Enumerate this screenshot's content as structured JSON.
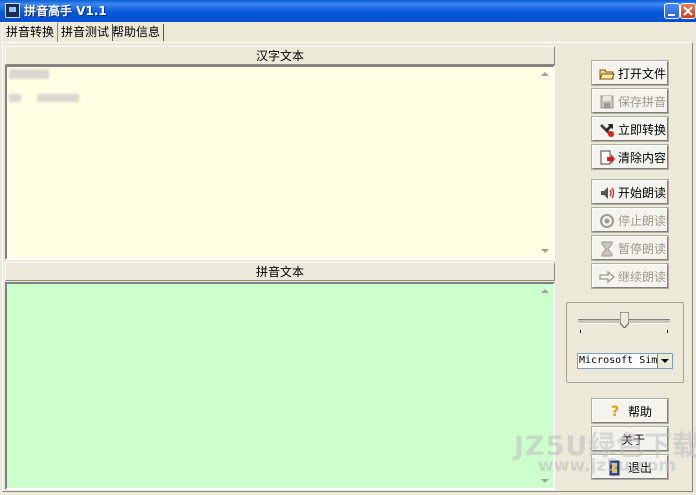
{
  "window": {
    "title": "拼音高手 V1.1"
  },
  "tabs": [
    {
      "label": "拼音转换"
    },
    {
      "label": "拼音测试"
    },
    {
      "label": "帮助信息"
    }
  ],
  "hanzi_panel": {
    "header": "汉字文本",
    "background": "#ffffe4"
  },
  "pinyin_panel": {
    "header": "拼音文本",
    "background": "#ccffcc"
  },
  "buttons": {
    "open_file": "打开文件",
    "save_pinyin": "保存拼音",
    "convert_now": "立即转换",
    "clear_content": "清除内容",
    "start_reading": "开始朗读",
    "stop_reading": "停止朗读",
    "pause_reading": "暂停朗读",
    "resume_reading": "继续朗读",
    "help": "帮助",
    "about": "关于",
    "exit": "退出"
  },
  "voice": {
    "speed_level": 0.5,
    "selected_voice": "Microsoft Simpl"
  },
  "watermark": {
    "main": "JZ5U绿色下载",
    "sub": "www.jz5u.com"
  }
}
